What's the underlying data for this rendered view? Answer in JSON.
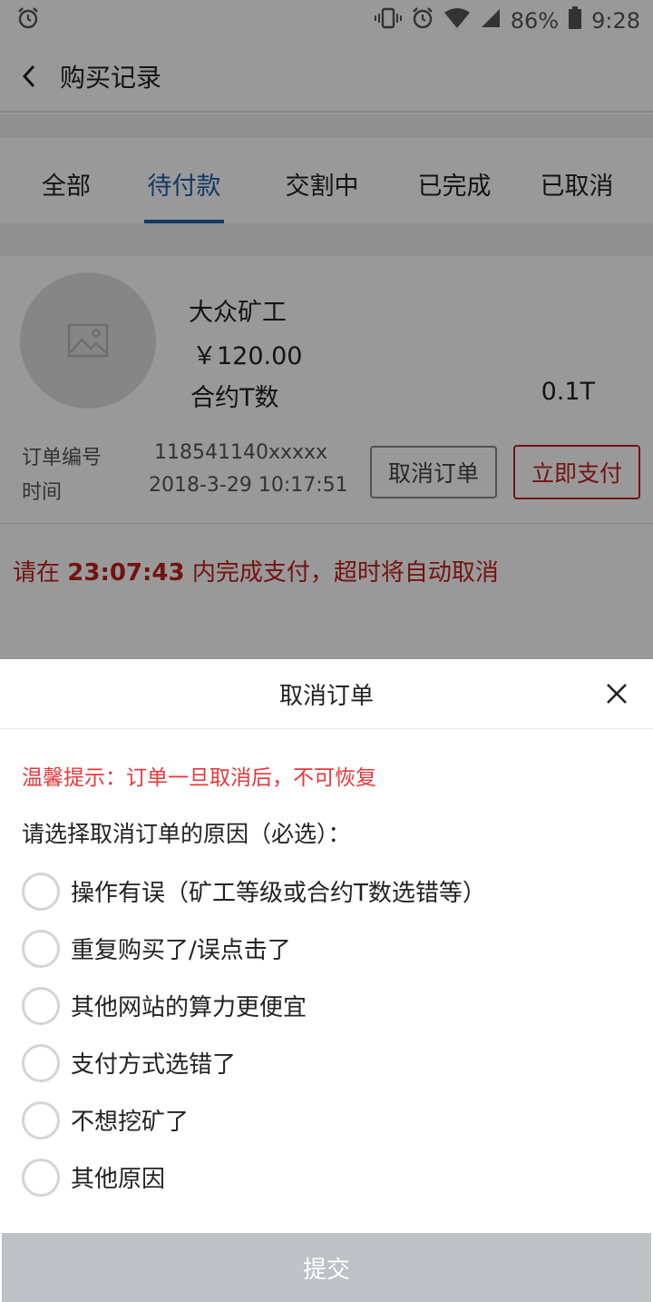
{
  "status_bar": {
    "battery": "86%",
    "time": "9:28"
  },
  "header": {
    "title": "购买记录"
  },
  "tabs": [
    {
      "label": "全部",
      "active": false
    },
    {
      "label": "待付款",
      "active": true
    },
    {
      "label": "交割中",
      "active": false
    },
    {
      "label": "已完成",
      "active": false
    },
    {
      "label": "已取消",
      "active": false
    }
  ],
  "order": {
    "product_name": "大众矿工",
    "price": "￥120.00",
    "spec_label": "合约T数",
    "spec_value": "0.1T",
    "order_no_label": "订单编号",
    "order_no": "118541140xxxxx",
    "time_label": "时间",
    "time": "2018-3-29 10:17:51",
    "cancel_button": "取消订单",
    "pay_button": "立即支付",
    "deadline_prefix": "请在 ",
    "deadline_time": "23:07:43",
    "deadline_suffix": " 内完成支付，超时将自动取消"
  },
  "cancel_sheet": {
    "title": "取消订单",
    "tip": "温馨提示：订单一旦取消后，不可恢复",
    "prompt": "请选择取消订单的原因（必选）：",
    "reasons": [
      "操作有误（矿工等级或合约T数选错等）",
      "重复购买了/误点击了",
      "其他网站的算力更便宜",
      "支付方式选错了",
      "不想挖矿了",
      "其他原因"
    ],
    "submit_label": "提交"
  },
  "colors": {
    "accent_blue": "#1e5fa8",
    "danger_red": "#c0201d",
    "tip_red": "#e5383b",
    "submit_disabled": "#bec1c6"
  }
}
